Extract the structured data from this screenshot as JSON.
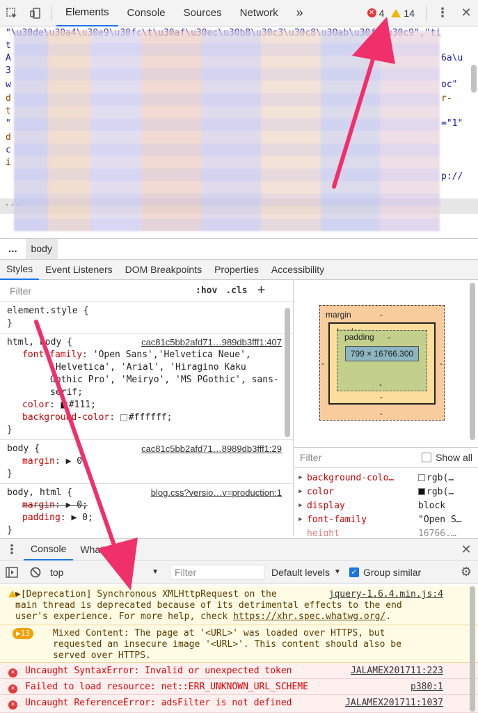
{
  "toolbar": {
    "tabs": [
      "Elements",
      "Console",
      "Sources",
      "Network"
    ],
    "more": "»",
    "errors": "4",
    "warnings": "14"
  },
  "source": {
    "line1": "\"\\u30de\\u30a4\\u30e9\\u30fc\\t\\u30af\\u30ec\\u30b8\\u30c3\\u30c8\\u30ab\\u30fc\\u30c9\",\"ti",
    "frag_t": "t",
    "frag_a": "A",
    "frag_3": "3",
    "frag_w": "w",
    "frag_d": "d",
    "frag_ty": "t",
    "frag_q": "\"",
    "frag_d2": "d",
    "frag_c": "c",
    "frag_i": "i",
    "right1": "6a\\u",
    "right2": "oc\"",
    "right3": "r-",
    "right4": "=\"1\"",
    "right5": "p://",
    "dots": "..."
  },
  "breadcrumb": {
    "more": "...",
    "body": "body"
  },
  "style_tabs": [
    "Styles",
    "Event Listeners",
    "DOM Breakpoints",
    "Properties",
    "Accessibility"
  ],
  "styles": {
    "filter_placeholder": "Filter",
    "hov": ":hov",
    "cls": ".cls",
    "plus": "+",
    "element_style": "element.style {",
    "close": "}",
    "rule1": {
      "selector": "html, body {",
      "source": "cac81c5bb2afd71…989db3fff1:407",
      "ff_name": "font-family",
      "ff_val1": "'Open Sans','Helvetica Neue',",
      "ff_val2": "'Helvetica', 'Arial', 'Hiragino Kaku",
      "ff_val3": "Gothic Pro', 'Meiryo', 'MS PGothic', sans-",
      "ff_val4": "serif;",
      "color_name": "color",
      "color_val": "#111;",
      "bg_name": "background-color",
      "bg_val": "#ffffff;"
    },
    "rule2": {
      "selector": "body {",
      "source": "cac81c5bb2afd71…8989db3fff1:29",
      "margin_name": "margin",
      "margin_val": "▶ 0"
    },
    "rule3": {
      "selector": "body, html {",
      "source": "blog.css?versio…v=production:1",
      "margin_name": "margin",
      "margin_val": "▶ 0;",
      "padding_name": "padding",
      "padding_val": "▶ 0;"
    }
  },
  "boxmodel": {
    "margin": "margin",
    "border": "border",
    "padding": "padding",
    "dash": "-",
    "content": "799 × 16766.300"
  },
  "computed": {
    "filter": "Filter",
    "show_all": "Show all",
    "rows": [
      {
        "name": "background-colo…",
        "value": "rgb(…"
      },
      {
        "name": "color",
        "value": "rgb(…"
      },
      {
        "name": "display",
        "value": "block"
      },
      {
        "name": "font-family",
        "value": "\"Open S…"
      },
      {
        "name": "height",
        "value": "16766.…"
      }
    ]
  },
  "drawer": {
    "tabs": [
      "Console",
      "What's New"
    ],
    "context": "top",
    "filter": "Filter",
    "levels": "Default levels",
    "group": "Group similar"
  },
  "messages": {
    "m1_text1": "▶[Deprecation] Synchronous XMLHttpRequest on the",
    "m1_text2": "main thread is deprecated because of its detrimental effects to the end",
    "m1_text3": "user's experience. For more help, check ",
    "m1_link": "https://xhr.spec.whatwg.org/",
    "m1_end": ".",
    "m1_loc": "jquery-1.6.4.min.js:4",
    "m2_badge": "▶13",
    "m2_text1": "Mixed Content: The page at '<URL>' was loaded over HTTPS, but",
    "m2_text2": "requested an insecure image '<URL>'. This content should also be",
    "m2_text3": "served over HTTPS.",
    "m3_text": "Uncaught SyntaxError: Invalid or unexpected token",
    "m3_loc": "JALAMEX201711:223",
    "m4_text": "Failed to load resource: net::ERR_UNKNOWN_URL_SCHEME",
    "m4_loc": "p380:1",
    "m5_text": "Uncaught ReferenceError: adsFilter is not defined",
    "m5_loc": "JALAMEX201711:1037"
  },
  "colors": {
    "arrow": "#f0306a",
    "accent": "#1a73e8",
    "error": "#e03a3a",
    "warning": "#f4b400"
  }
}
